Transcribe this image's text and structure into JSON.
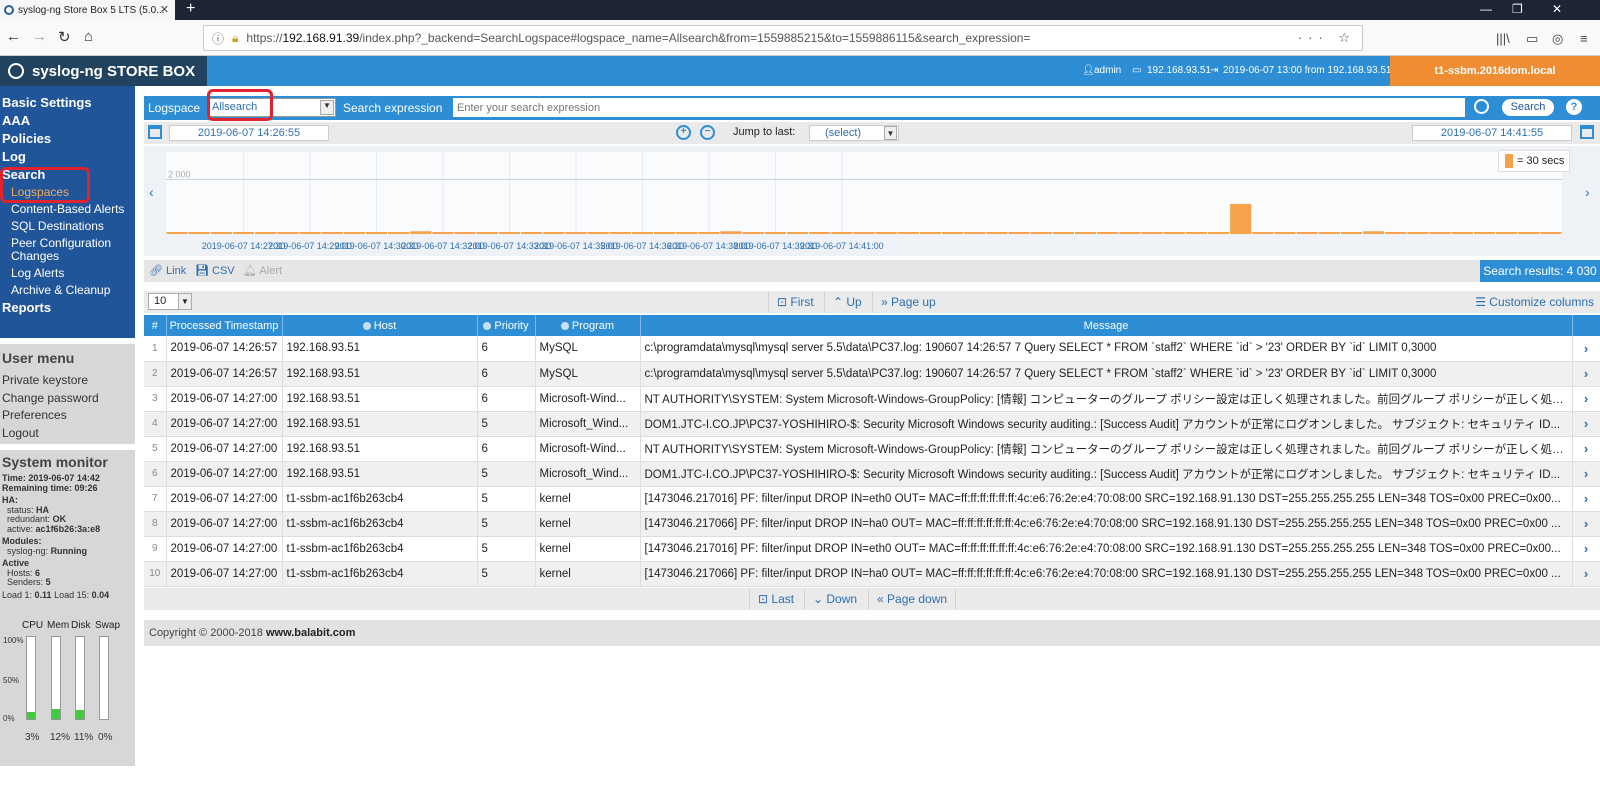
{
  "browser": {
    "tab_title": "syslog-ng Store Box 5 LTS (5.0...",
    "url_prefix": "https://",
    "url_host": "192.168.91.39",
    "url_path": "/index.php?_backend=SearchLogspace#logspace_name=Allsearch&from=1559885215&to=1559886115&search_expression="
  },
  "app": {
    "logo": "syslog-ng STORE BOX",
    "user": "admin",
    "client_ip": "192.168.93.51",
    "last_login": "2019-06-07 13:00 from 192.168.93.51",
    "hostname": "t1-ssbm.2016dom.local"
  },
  "sidebar": {
    "items": [
      {
        "label": "Basic Settings",
        "type": "top"
      },
      {
        "label": "AAA",
        "type": "top"
      },
      {
        "label": "Policies",
        "type": "top"
      },
      {
        "label": "Log",
        "type": "top"
      },
      {
        "label": "Search",
        "type": "top"
      },
      {
        "label": "Logspaces",
        "type": "sub",
        "active": true
      },
      {
        "label": "Content-Based Alerts",
        "type": "sub"
      },
      {
        "label": "SQL Destinations",
        "type": "sub"
      },
      {
        "label": "Peer Configuration Changes",
        "type": "sub"
      },
      {
        "label": "Log Alerts",
        "type": "sub"
      },
      {
        "label": "Archive & Cleanup",
        "type": "sub"
      },
      {
        "label": "Reports",
        "type": "top"
      }
    ]
  },
  "user_menu": {
    "title": "User menu",
    "items": [
      "Private keystore",
      "Change password",
      "Preferences",
      "Logout"
    ]
  },
  "system_monitor": {
    "title": "System monitor",
    "time_label": "Time:",
    "time": "2019-06-07 14:42",
    "remaining_label": "Remaining time:",
    "remaining": "09:26",
    "ha_label": "HA:",
    "status_label": "status:",
    "status": "HA",
    "redundant_label": "redundant:",
    "redundant": "OK",
    "active_label": "active:",
    "active": "ac1f6b26:3a:e8",
    "modules_label": "Modules:",
    "syslogng_label": "syslog-ng:",
    "syslogng": "Running",
    "active_hdr": "Active",
    "hosts_label": "Hosts:",
    "hosts": "6",
    "senders_label": "Senders:",
    "senders": "5",
    "load1_label": "Load 1:",
    "load1": "0.11",
    "load15_label": "Load 15:",
    "load15": "0.04",
    "gauges": [
      {
        "label": "CPU",
        "value": "3%",
        "fraction": 0.03
      },
      {
        "label": "Mem",
        "value": "12%",
        "fraction": 0.12
      },
      {
        "label": "Disk",
        "value": "11%",
        "fraction": 0.11
      },
      {
        "label": "Swap",
        "value": "0%",
        "fraction": 0.0
      }
    ],
    "tick_100": "100%",
    "tick_50": "50%",
    "tick_0": "0%"
  },
  "search": {
    "logspace_label": "Logspace",
    "logspace_value": "Allsearch",
    "expr_label": "Search expression",
    "expr_placeholder": "Enter your search expression",
    "search_button": "Search",
    "help": "?"
  },
  "dates": {
    "from": "2019-06-07 14:26:55",
    "to": "2019-06-07 14:41:55",
    "jump_label": "Jump to last:",
    "jump_value": "(select)"
  },
  "chart_data": {
    "type": "bar",
    "legend": "= 30 secs",
    "ytick": "2 000",
    "ylim": [
      0,
      3000
    ],
    "xticks": [
      "2019-06-07 14:27:30",
      "2019-06-07 14:29:00",
      "2019-06-07 14:30:30",
      "2019-06-07 14:32:00",
      "2019-06-07 14:33:30",
      "2019-06-07 14:35:00",
      "2019-06-07 14:36:30",
      "2019-06-07 14:38:00",
      "2019-06-07 14:39:30",
      "2019-06-07 14:41:00"
    ],
    "values": [
      60,
      60,
      60,
      60,
      60,
      60,
      60,
      60,
      60,
      60,
      60,
      100,
      60,
      60,
      60,
      60,
      60,
      60,
      60,
      60,
      60,
      60,
      60,
      60,
      60,
      100,
      60,
      60,
      60,
      60,
      60,
      60,
      60,
      60,
      60,
      60,
      60,
      60,
      60,
      60,
      60,
      60,
      60,
      60,
      60,
      60,
      60,
      60,
      1100,
      60,
      60,
      60,
      60,
      60,
      100,
      60,
      60,
      60,
      60,
      60,
      60,
      60,
      60
    ]
  },
  "actions": {
    "link": "Link",
    "csv": "CSV",
    "alert": "Alert",
    "results": "Search results: 4 030"
  },
  "pager": {
    "page_size": "10",
    "first": "First",
    "up": "Up",
    "page_up": "Page up",
    "last": "Last",
    "down": "Down",
    "page_down": "Page down",
    "customize": "Customize columns"
  },
  "table": {
    "headers": [
      "#",
      "Processed Timestamp",
      "Host",
      "Priority",
      "Program",
      "Message"
    ],
    "rows": [
      [
        "1",
        "2019-06-07 14:26:57",
        "192.168.93.51",
        "6",
        "MySQL",
        "c:\\programdata\\mysql\\mysql server 5.5\\data\\PC37.log: 190607 14:26:57 7 Query SELECT * FROM `staff2` WHERE `id` > '23' ORDER BY `id` LIMIT 0,3000"
      ],
      [
        "2",
        "2019-06-07 14:26:57",
        "192.168.93.51",
        "6",
        "MySQL",
        "c:\\programdata\\mysql\\mysql server 5.5\\data\\PC37.log: 190607 14:26:57 7 Query SELECT * FROM `staff2` WHERE `id` > '23' ORDER BY `id` LIMIT 0,3000"
      ],
      [
        "3",
        "2019-06-07 14:27:00",
        "192.168.93.51",
        "6",
        "Microsoft-Wind...",
        "NT AUTHORITY\\SYSTEM: System Microsoft-Windows-GroupPolicy: [情報] コンピューターのグループ ポリシー設定は正しく処理されました。前回グループ ポリシーが正しく処理..."
      ],
      [
        "4",
        "2019-06-07 14:27:00",
        "192.168.93.51",
        "5",
        "Microsoft_Wind...",
        "DOM1.JTC-I.CO.JP\\PC37-YOSHIHIRO-$: Security Microsoft Windows security auditing.: [Success Audit] アカウントが正常にログオンしました。 サブジェクト: セキュリティ ID..."
      ],
      [
        "5",
        "2019-06-07 14:27:00",
        "192.168.93.51",
        "6",
        "Microsoft-Wind...",
        "NT AUTHORITY\\SYSTEM: System Microsoft-Windows-GroupPolicy: [情報] コンピューターのグループ ポリシー設定は正しく処理されました。前回グループ ポリシーが正しく処理..."
      ],
      [
        "6",
        "2019-06-07 14:27:00",
        "192.168.93.51",
        "5",
        "Microsoft_Wind...",
        "DOM1.JTC-I.CO.JP\\PC37-YOSHIHIRO-$: Security Microsoft Windows security auditing.: [Success Audit] アカウントが正常にログオンしました。 サブジェクト: セキュリティ ID..."
      ],
      [
        "7",
        "2019-06-07 14:27:00",
        "t1-ssbm-ac1f6b263cb4",
        "5",
        "kernel",
        "[1473046.217016] PF: filter/input DROP IN=eth0 OUT= MAC=ff:ff:ff:ff:ff:ff:4c:e6:76:2e:e4:70:08:00 SRC=192.168.91.130 DST=255.255.255.255 LEN=348 TOS=0x00 PREC=0x00..."
      ],
      [
        "8",
        "2019-06-07 14:27:00",
        "t1-ssbm-ac1f6b263cb4",
        "5",
        "kernel",
        "[1473046.217066] PF: filter/input DROP IN=ha0 OUT= MAC=ff:ff:ff:ff:ff:ff:4c:e6:76:2e:e4:70:08:00 SRC=192.168.91.130 DST=255.255.255.255 LEN=348 TOS=0x00 PREC=0x00 ..."
      ],
      [
        "9",
        "2019-06-07 14:27:00",
        "t1-ssbm-ac1f6b263cb4",
        "5",
        "kernel",
        "[1473046.217016] PF: filter/input DROP IN=eth0 OUT= MAC=ff:ff:ff:ff:ff:ff:4c:e6:76:2e:e4:70:08:00 SRC=192.168.91.130 DST=255.255.255.255 LEN=348 TOS=0x00 PREC=0x00..."
      ],
      [
        "10",
        "2019-06-07 14:27:00",
        "t1-ssbm-ac1f6b263cb4",
        "5",
        "kernel",
        "[1473046.217066] PF: filter/input DROP IN=ha0 OUT= MAC=ff:ff:ff:ff:ff:ff:4c:e6:76:2e:e4:70:08:00 SRC=192.168.91.130 DST=255.255.255.255 LEN=348 TOS=0x00 PREC=0x00 ..."
      ]
    ]
  },
  "footer": {
    "copyright": "Copyright © 2000-2018",
    "site": "www.balabit.com"
  },
  "colors": {
    "header_blue": "#2d8ed6",
    "sidebar_navy": "#21559a",
    "host_orange": "#f08c32",
    "bar_orange": "#f5a24a",
    "highlight_red": "#e0232e"
  }
}
